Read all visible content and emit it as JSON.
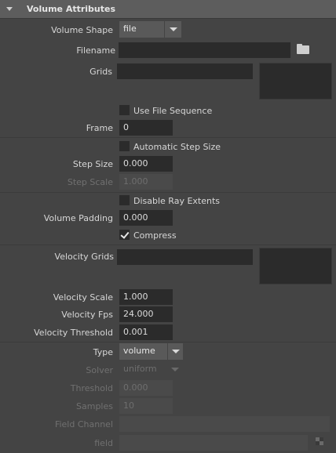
{
  "section": {
    "title": "Volume Attributes"
  },
  "volume_shape": {
    "label": "Volume Shape",
    "value": "file"
  },
  "filename": {
    "label": "Filename",
    "value": "",
    "icon": "folder-icon"
  },
  "grids": {
    "label": "Grids"
  },
  "use_file_sequence": {
    "label": "Use File Sequence",
    "checked": false
  },
  "frame": {
    "label": "Frame",
    "value": "0"
  },
  "automatic_step_size": {
    "label": "Automatic Step Size",
    "checked": false
  },
  "step_size": {
    "label": "Step Size",
    "value": "0.000"
  },
  "step_scale": {
    "label": "Step Scale",
    "value": "1.000",
    "disabled": true
  },
  "disable_ray_extents": {
    "label": "Disable Ray Extents",
    "checked": false
  },
  "volume_padding": {
    "label": "Volume Padding",
    "value": "0.000"
  },
  "compress": {
    "label": "Compress",
    "checked": true
  },
  "velocity_grids": {
    "label": "Velocity Grids"
  },
  "velocity_scale": {
    "label": "Velocity Scale",
    "value": "1.000"
  },
  "velocity_fps": {
    "label": "Velocity Fps",
    "value": "24.000"
  },
  "velocity_threshold": {
    "label": "Velocity Threshold",
    "value": "0.001"
  },
  "type": {
    "label": "Type",
    "value": "volume"
  },
  "solver": {
    "label": "Solver",
    "value": "uniform",
    "disabled": true
  },
  "threshold": {
    "label": "Threshold",
    "value": "0.000",
    "disabled": true
  },
  "samples": {
    "label": "Samples",
    "value": "10",
    "disabled": true
  },
  "field_channel": {
    "label": "Field Channel",
    "value": "",
    "disabled": true
  },
  "field": {
    "label": "field",
    "value": "",
    "disabled": true,
    "icon": "map-button-icon"
  }
}
